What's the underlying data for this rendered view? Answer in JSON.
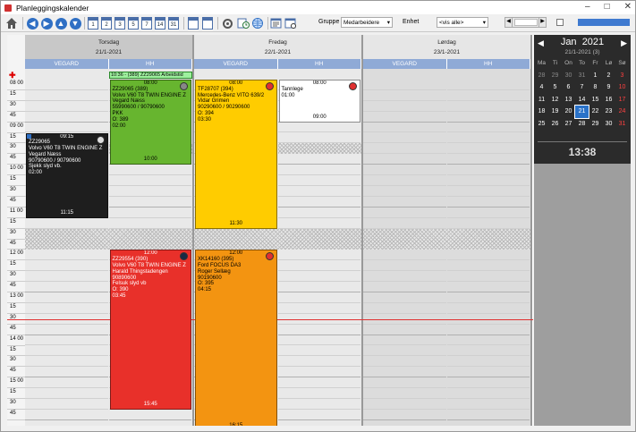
{
  "window": {
    "title": "Planleggingskalender"
  },
  "toolbar": {
    "calendar_buttons": [
      "1",
      "2",
      "3",
      "5",
      "7",
      "14",
      "31"
    ],
    "group_label": "Gruppe",
    "group_value": "Medarbeidere",
    "unit_label": "Enhet",
    "unit_value": "<vis alle>"
  },
  "days": [
    {
      "name": "Torsdag",
      "date": "21/1-2021",
      "resources": [
        "VEGARD",
        "HH"
      ]
    },
    {
      "name": "Fredag",
      "date": "22/1-2021",
      "resources": [
        "VEGARD",
        "HH"
      ]
    },
    {
      "name": "Lørdag",
      "date": "23/1-2021",
      "resources": [
        "VEGARD",
        "HH"
      ]
    }
  ],
  "times": [
    "08 00",
    "15",
    "30",
    "45",
    "09 00",
    "15",
    "30",
    "45",
    "10 00",
    "15",
    "30",
    "45",
    "11 00",
    "15",
    "30",
    "45",
    "12 00",
    "15",
    "30",
    "45",
    "13 00",
    "15",
    "30",
    "45",
    "14 00",
    "15",
    "30",
    "45",
    "15 00",
    "15",
    "30",
    "45"
  ],
  "banner": {
    "text": "10:36 - (389) ZZ29065 Arbeidstid"
  },
  "appointments": [
    {
      "id": "a1",
      "start": "09:15",
      "end": "11:15",
      "lines": [
        "ZZ29065",
        "Volvo V60 T8 TWIN ENGINE Z",
        "Vegard  Næss",
        "90790600 / 90790600",
        "Sjekk slyd vb.",
        "02:00"
      ]
    },
    {
      "id": "a2",
      "start": "08:00",
      "end": "10:00",
      "lines": [
        "ZZ29065 (389)",
        "Volvo V60 T8 TWIN ENGINE Z",
        "Vegard Næss",
        "55990600 / 90790600",
        "PKK",
        "O: 389",
        "02:00"
      ]
    },
    {
      "id": "a3",
      "start": "08:00",
      "end": "11:30",
      "lines": [
        "TF28707 (394)",
        "Mercedes-Benz VITO 639/2",
        "Vidar Grimen",
        "90290600 / 90290600",
        "O: 394",
        "03:30"
      ]
    },
    {
      "id": "a4",
      "start": "08:00",
      "end": "09:00",
      "lines": [
        "Tannlege",
        "01:00"
      ]
    },
    {
      "id": "a5",
      "start": "12:00",
      "end": "15:45",
      "lines": [
        "ZZ29554 (390)",
        "Volvo V60 T8 TWIN ENGINE Z",
        "Harald Thingstadengen",
        "90890600",
        "Felsuk slyd vb",
        "O: 390",
        "03:45"
      ]
    },
    {
      "id": "a6",
      "start": "12:00",
      "end": "16:15",
      "lines": [
        "XK14160 (395)",
        "Ford FOCUS DA3",
        "Roger Sellæg",
        "90190600",
        "O: 395",
        "04:15"
      ]
    }
  ],
  "mini_calendar": {
    "month": "Jan",
    "year": "2021",
    "selected": "21/1-2021 (3)",
    "weekdays": [
      "Ma",
      "Ti",
      "On",
      "To",
      "Fr",
      "Lø",
      "Sø"
    ],
    "weeks": [
      [
        "28",
        "29",
        "30",
        "31",
        "1",
        "2",
        "3"
      ],
      [
        "4",
        "5",
        "6",
        "7",
        "8",
        "9",
        "10"
      ],
      [
        "11",
        "12",
        "13",
        "14",
        "15",
        "16",
        "17"
      ],
      [
        "18",
        "19",
        "20",
        "21",
        "22",
        "23",
        "24"
      ],
      [
        "25",
        "26",
        "27",
        "28",
        "29",
        "30",
        "31"
      ]
    ],
    "clock": "13:38",
    "colors": {
      "bg": "#2b2b2b",
      "sunday": "#ff4040",
      "today": "#2a72c8"
    }
  }
}
